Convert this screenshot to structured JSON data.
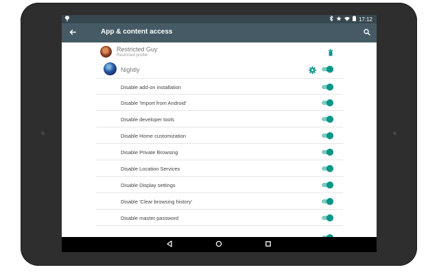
{
  "statusbar": {
    "time": "17:12",
    "icons": [
      "notification-icon",
      "bluetooth-icon",
      "star-icon",
      "wifi-icon",
      "battery-icon"
    ]
  },
  "appbar": {
    "title": "App & content access",
    "back_icon": "arrow-back-icon",
    "search_icon": "search-icon",
    "background": "#455a64"
  },
  "profiles": [
    {
      "name": "Restricted Guy",
      "subtitle": "Restricted profile",
      "action_icon": "delete-icon"
    },
    {
      "name": "Nightly",
      "action_icon": "gear-icon",
      "toggle_on": true
    }
  ],
  "settings": [
    {
      "label": "Disable add-on installation",
      "on": true
    },
    {
      "label": "Disable 'Import from Android'",
      "on": true
    },
    {
      "label": "Disable developer tools",
      "on": true
    },
    {
      "label": "Disable Home customization",
      "on": true
    },
    {
      "label": "Disable Private Browsing",
      "on": true
    },
    {
      "label": "Disable Location Services",
      "on": true
    },
    {
      "label": "Disable Display settings",
      "on": true
    },
    {
      "label": "Disable 'Clear browsing history'",
      "on": true
    },
    {
      "label": "Disable master password",
      "on": true
    }
  ],
  "navbar": {
    "icons": [
      "nav-back-icon",
      "nav-home-icon",
      "nav-recents-icon"
    ]
  },
  "colors": {
    "accent": "#009688",
    "statusbar": "#37474f",
    "bezel": "#2e2e2e"
  }
}
